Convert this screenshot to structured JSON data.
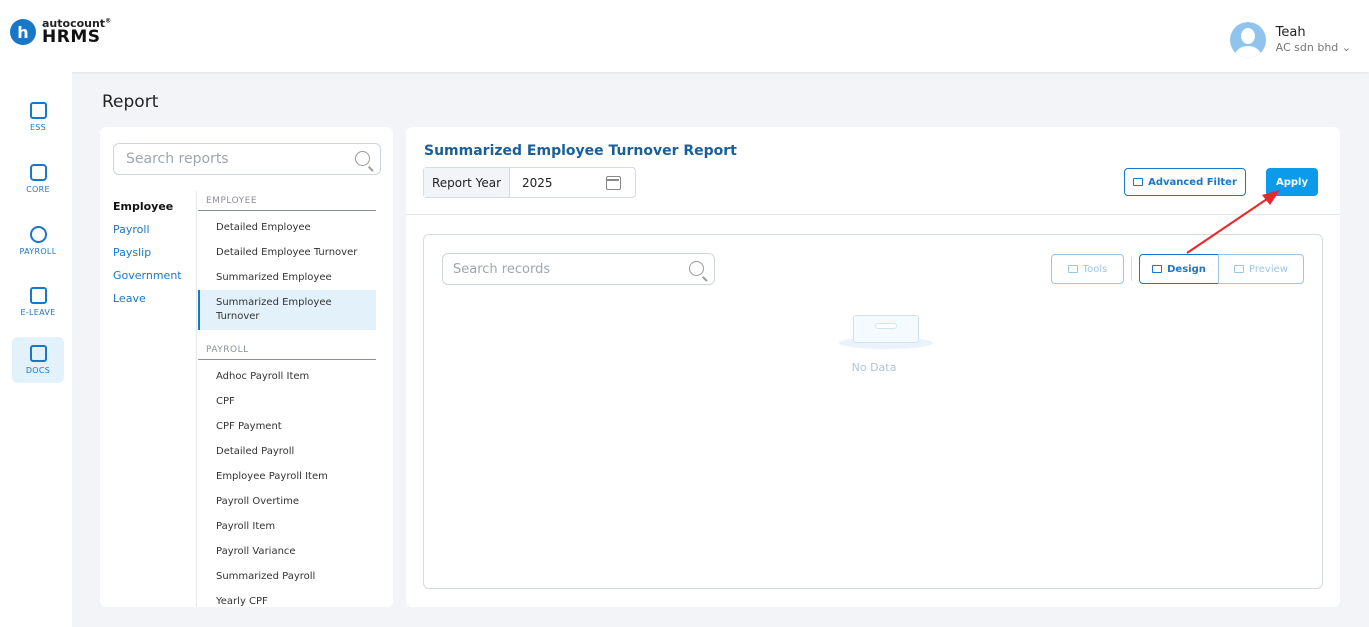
{
  "brand": {
    "top": "autocount",
    "reg": "®",
    "bottom": "HRMS",
    "badge": "h"
  },
  "user": {
    "name": "Teah",
    "company": "AC sdn bhd ⌄"
  },
  "rail": [
    {
      "label": "ESS",
      "icon": "id-card-icon"
    },
    {
      "label": "CORE",
      "icon": "cube-icon"
    },
    {
      "label": "PAYROLL",
      "icon": "dollar-circle-icon"
    },
    {
      "label": "E-LEAVE",
      "icon": "calendar-icon"
    },
    {
      "label": "DOCS",
      "icon": "document-chart-icon"
    }
  ],
  "page": {
    "title": "Report"
  },
  "left": {
    "search_placeholder": "Search reports",
    "categories": [
      "Employee",
      "Payroll",
      "Payslip",
      "Government",
      "Leave"
    ],
    "sections": [
      {
        "title": "EMPLOYEE",
        "items": [
          "Detailed Employee",
          "Detailed Employee Turnover",
          "Summarized Employee",
          "Summarized Employee Turnover"
        ]
      },
      {
        "title": "PAYROLL",
        "items": [
          "Adhoc Payroll Item",
          "CPF",
          "CPF Payment",
          "Detailed Payroll",
          "Employee Payroll Item",
          "Payroll Overtime",
          "Payroll Item",
          "Payroll Variance",
          "Summarized Payroll",
          "Yearly CPF"
        ]
      }
    ]
  },
  "main": {
    "title": "Summarized Employee Turnover Report",
    "year_label": "Report Year",
    "year_value": "2025",
    "advanced_filter": "Advanced Filter",
    "apply": "Apply",
    "search_placeholder": "Search records",
    "tools": "Tools",
    "design": "Design",
    "preview": "Preview",
    "no_data": "No Data"
  },
  "colors": {
    "accent": "#1877c9",
    "apply": "#0b9bea",
    "arrow": "#e8282b"
  }
}
